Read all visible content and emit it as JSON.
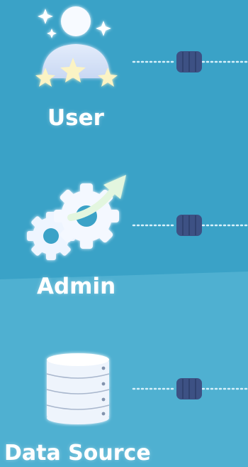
{
  "colors": {
    "background_upper": "#3aa2c7",
    "background_lower": "#4fb0d1",
    "icon_fill": "#eef5ff",
    "icon_glow": "#cdeefa",
    "star": "#fbf3c4",
    "arrow": "#e3f6df",
    "connector_dots": "#d6f0fa",
    "connector_block": "#3d5184"
  },
  "nodes": [
    {
      "id": "user",
      "label": "User",
      "icon": "user-with-stars-icon"
    },
    {
      "id": "admin",
      "label": "Admin",
      "icon": "gears-with-arrow-icon"
    },
    {
      "id": "data_source",
      "label": "Data Source",
      "icon": "database-icon"
    }
  ]
}
